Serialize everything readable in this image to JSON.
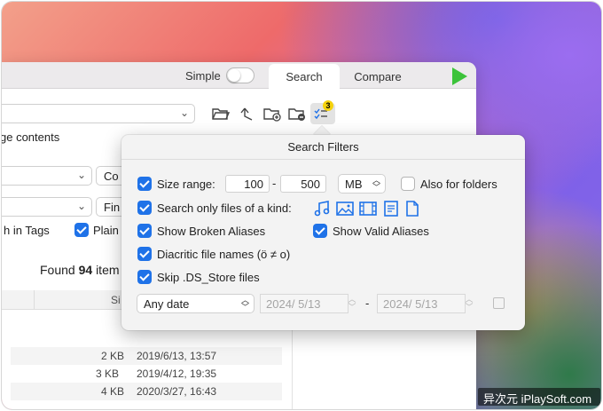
{
  "toolbar": {
    "simple_label": "Simple",
    "tabs": [
      {
        "label": "Search",
        "active": true
      },
      {
        "label": "Compare",
        "active": false
      }
    ],
    "filter_badge": "3"
  },
  "search_panel": {
    "page_contents_label": "ge contents",
    "select_partial": "Co",
    "find_partial": "Fin",
    "search_in_tags_label": "h in Tags",
    "plain_label": "Plain",
    "found_prefix": "Found",
    "found_count": "94",
    "found_suffix": "item",
    "size_header": "Si"
  },
  "results": [
    {
      "size": "",
      "date": ""
    },
    {
      "size": "2 KB",
      "date": "2019/6/13, 13:57"
    },
    {
      "size": "3 KB",
      "date": "2019/4/12, 19:35"
    },
    {
      "size": "4 KB",
      "date": "2020/3/27, 16:43"
    }
  ],
  "filters": {
    "title": "Search Filters",
    "size_range_label": "Size range:",
    "size_min": "100",
    "size_dash": "-",
    "size_max": "500",
    "unit": "MB",
    "also_folders_label": "Also for folders",
    "only_kind_label": "Search only files of a kind:",
    "kind_icons": [
      "music-icon",
      "image-icon",
      "movie-icon",
      "text-doc-icon",
      "blank-doc-icon"
    ],
    "broken_aliases_label": "Show Broken Aliases",
    "valid_aliases_label": "Show Valid Aliases",
    "diacritic_label": "Diacritic file names (ö ≠ o)",
    "skip_ds_store_label": "Skip .DS_Store files",
    "date_mode": "Any date",
    "date_from": "2024/  5/13",
    "date_dash": "-",
    "date_to": "2024/  5/13",
    "checked": {
      "size_range": true,
      "also_folders": false,
      "only_kind": true,
      "broken_aliases": true,
      "valid_aliases": true,
      "diacritic": true,
      "skip_ds_store": true
    }
  },
  "watermark": "异次元 iPlaySoft.com",
  "colors": {
    "accent": "#1f72e8",
    "run_button": "#3cc33a",
    "badge": "#f5d20c"
  }
}
